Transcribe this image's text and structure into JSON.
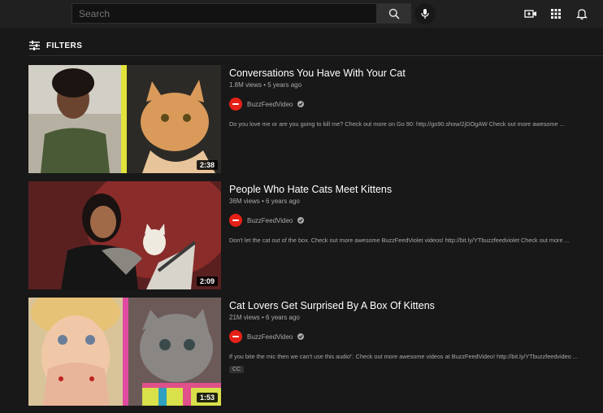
{
  "header": {
    "search_placeholder": "Search",
    "icons": [
      "search-icon",
      "mic-icon",
      "create-video-icon",
      "apps-icon",
      "bell-icon"
    ]
  },
  "filters": {
    "label": "FILTERS",
    "icon": "filter-icon"
  },
  "videos": [
    {
      "title": "Conversations You Have With Your Cat",
      "meta": "1.8M views • 5 years ago",
      "channel": "BuzzFeedVideo",
      "description": "Do you love me or are you going to kill me? Check out more on Go 90: http://go90.show/2jDOgAW Check out more awesome ...",
      "duration": "2:38"
    },
    {
      "title": "People Who Hate Cats Meet Kittens",
      "meta": "36M views • 6 years ago",
      "channel": "BuzzFeedVideo",
      "description": "Don't let the cat out of the box. Check out more awesome BuzzFeedViolet videos! http://bit.ly/YTbuzzfeedviolet Check out more ...",
      "duration": "2:09"
    },
    {
      "title": "Cat Lovers Get Surprised By A Box Of Kittens",
      "meta": "21M views • 6 years ago",
      "channel": "BuzzFeedVideo",
      "description": "If you bite the mic then we can't use this audio\". Check out more awesome videos at BuzzFeedVideo! http://bit.ly/YTbuzzfeedvideo ...",
      "duration": "1:53",
      "badge": "CC"
    }
  ],
  "colors": {
    "background": "#181818",
    "header": "#202020",
    "channel_avatar": "#e62117"
  }
}
